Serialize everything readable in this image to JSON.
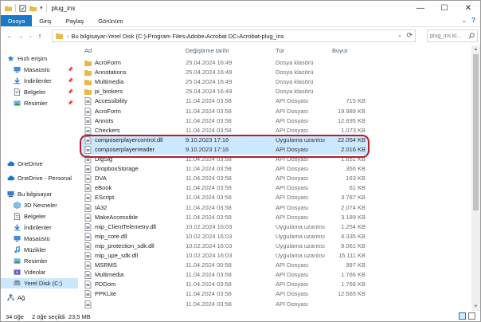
{
  "window": {
    "title": "plug_ins",
    "controls": {
      "minimize": "—",
      "maximize": "☐",
      "close": "✕"
    }
  },
  "ribbon": {
    "tabs": [
      "Dosya",
      "Giriş",
      "Paylaş",
      "Görünüm"
    ],
    "right_chevron": "⌄",
    "help": "?"
  },
  "navigation": {
    "back": "←",
    "forward": "→",
    "recent": "⌄",
    "up": "↑"
  },
  "address": {
    "crumbs": [
      "Bu bilgisayar",
      "Yerel Disk (C:)",
      "Program Files",
      "Adobe",
      "Acrobat DC",
      "Acrobat",
      "plug_ins"
    ],
    "separator": "›",
    "dropdown": "⌄",
    "refresh": "⟳"
  },
  "search": {
    "placeholder": "plug_ins kl..."
  },
  "nav_pane": {
    "items": [
      {
        "label": "Hızlı erişim",
        "icon": "star-icon",
        "pinned": false,
        "selected": false,
        "chevron": ""
      },
      {
        "label": "Masaüstü",
        "icon": "desktop-icon",
        "pinned": true,
        "selected": false,
        "chevron": ""
      },
      {
        "label": "İndirilenler",
        "icon": "download-icon",
        "pinned": true,
        "selected": false,
        "chevron": ""
      },
      {
        "label": "Belgeler",
        "icon": "documents-icon",
        "pinned": true,
        "selected": false,
        "chevron": ""
      },
      {
        "label": "Resimler",
        "icon": "pictures-icon",
        "pinned": true,
        "selected": false,
        "chevron": ""
      },
      {
        "label": "OneDrive",
        "icon": "cloud-icon",
        "pinned": false,
        "selected": false,
        "chevron": ""
      },
      {
        "label": "OneDrive - Personal",
        "icon": "cloud-icon",
        "pinned": false,
        "selected": false,
        "chevron": ""
      },
      {
        "label": "Bu bilgisayar",
        "icon": "computer-icon",
        "pinned": false,
        "selected": false,
        "chevron": ""
      },
      {
        "label": "3D Nesneler",
        "icon": "3d-objects-icon",
        "pinned": false,
        "selected": false,
        "chevron": ""
      },
      {
        "label": "Belgeler",
        "icon": "documents-icon",
        "pinned": false,
        "selected": false,
        "chevron": ""
      },
      {
        "label": "İndirilenler",
        "icon": "download-icon",
        "pinned": false,
        "selected": false,
        "chevron": ""
      },
      {
        "label": "Masaüstü",
        "icon": "desktop-icon",
        "pinned": false,
        "selected": false,
        "chevron": ""
      },
      {
        "label": "Müzikler",
        "icon": "music-icon",
        "pinned": false,
        "selected": false,
        "chevron": ""
      },
      {
        "label": "Resimler",
        "icon": "pictures-icon",
        "pinned": false,
        "selected": false,
        "chevron": ""
      },
      {
        "label": "Videolar",
        "icon": "videos-icon",
        "pinned": false,
        "selected": false,
        "chevron": ""
      },
      {
        "label": "Yerel Disk (C:)",
        "icon": "drive-icon",
        "pinned": false,
        "selected": true,
        "chevron": ""
      },
      {
        "label": "Ağ",
        "icon": "network-icon",
        "pinned": false,
        "selected": false,
        "chevron": ""
      }
    ]
  },
  "file_list": {
    "headers": {
      "name": "Ad",
      "date": "Değiştirme tarihi",
      "type": "Tür",
      "size": "Boyut"
    },
    "rows": [
      {
        "name": "AcroForm",
        "date": "25.04.2024 16:49",
        "type": "Dosya klasörü",
        "size": "",
        "kind": "folder",
        "selected": false
      },
      {
        "name": "Annotations",
        "date": "25.04.2024 16:49",
        "type": "Dosya klasörü",
        "size": "",
        "kind": "folder",
        "selected": false
      },
      {
        "name": "Multimedia",
        "date": "25.04.2024 16:49",
        "type": "Dosya klasörü",
        "size": "",
        "kind": "folder",
        "selected": false
      },
      {
        "name": "pi_brokers",
        "date": "25.04.2024 16:49",
        "type": "Dosya klasörü",
        "size": "",
        "kind": "folder",
        "selected": false
      },
      {
        "name": "Accessibility",
        "date": "11.04.2024 03:58",
        "type": "API Dosyası",
        "size": "715 KB",
        "kind": "file",
        "selected": false
      },
      {
        "name": "AcroForm",
        "date": "11.04.2024 03:58",
        "type": "API Dosyası",
        "size": "19.989 KB",
        "kind": "file",
        "selected": false
      },
      {
        "name": "Annots",
        "date": "11.04.2024 03:58",
        "type": "API Dosyası",
        "size": "12.695 KB",
        "kind": "file",
        "selected": false
      },
      {
        "name": "Checkers",
        "date": "11.04.2024 03:58",
        "type": "API Dosyası",
        "size": "1.073 KB",
        "kind": "file",
        "selected": false
      },
      {
        "name": "composerplayercontrol.dll",
        "date": "9.10.2023 17:16",
        "type": "Uygulama uzantısı",
        "size": "22.054 KB",
        "kind": "file",
        "selected": true
      },
      {
        "name": "composerplayerreader",
        "date": "9.10.2023 17:16",
        "type": "API Dosyası",
        "size": "2.016 KB",
        "kind": "file",
        "selected": true
      },
      {
        "name": "DigSig",
        "date": "11.04.2024 03:58",
        "type": "API Dosyası",
        "size": "1.651 KB",
        "kind": "file",
        "selected": false
      },
      {
        "name": "DropboxStorage",
        "date": "11.04.2024 03:58",
        "type": "API Dosyası",
        "size": "356 KB",
        "kind": "file",
        "selected": false
      },
      {
        "name": "DVA",
        "date": "11.04.2024 03:58",
        "type": "API Dosyası",
        "size": "163 KB",
        "kind": "file",
        "selected": false
      },
      {
        "name": "eBook",
        "date": "11.04.2024 03:58",
        "type": "API Dosyası",
        "size": "61 KB",
        "kind": "file",
        "selected": false
      },
      {
        "name": "EScript",
        "date": "11.04.2024 03:58",
        "type": "API Dosyası",
        "size": "3.787 KB",
        "kind": "file",
        "selected": false
      },
      {
        "name": "IA32",
        "date": "11.04.2024 03:58",
        "type": "API Dosyası",
        "size": "2.074 KB",
        "kind": "file",
        "selected": false
      },
      {
        "name": "MakeAccessible",
        "date": "11.04.2024 03:58",
        "type": "API Dosyası",
        "size": "3.189 KB",
        "kind": "file",
        "selected": false
      },
      {
        "name": "mip_ClientTelemetry.dll",
        "date": "10.02.2024 16:03",
        "type": "Uygulama uzantısı",
        "size": "1.254 KB",
        "kind": "file",
        "selected": false
      },
      {
        "name": "mip_core.dll",
        "date": "10.02.2024 16:03",
        "type": "Uygulama uzantısı",
        "size": "4.335 KB",
        "kind": "file",
        "selected": false
      },
      {
        "name": "mip_protection_sdk.dll",
        "date": "10.02.2024 16:03",
        "type": "Uygulama uzantısı",
        "size": "9.061 KB",
        "kind": "file",
        "selected": false
      },
      {
        "name": "mip_upe_sdk.dll",
        "date": "10.02.2024 16:03",
        "type": "Uygulama uzantısı",
        "size": "15.111 KB",
        "kind": "file",
        "selected": false
      },
      {
        "name": "MSRMS",
        "date": "11.04.2024 00:58",
        "type": "API Dosyası",
        "size": "997 KB",
        "kind": "file",
        "selected": false
      },
      {
        "name": "Multimedia",
        "date": "11.04.2024 03:58",
        "type": "API Dosyası",
        "size": "1.766 KB",
        "kind": "file",
        "selected": false
      },
      {
        "name": "PDDom",
        "date": "11.04.2024 03:58",
        "type": "API Dosyası",
        "size": "1.766 KB",
        "kind": "file",
        "selected": false
      },
      {
        "name": "PPKLite",
        "date": "11.04.2024 03:58",
        "type": "API Dosyası",
        "size": "12.665 KB",
        "kind": "file",
        "selected": false
      },
      {
        "name": "",
        "date": "11.04.2024 03:58",
        "type": "API Dosyası",
        "size": "",
        "kind": "file",
        "selected": false
      }
    ]
  },
  "status": {
    "item_count": "34 öğe",
    "selection": "2 öğe seçildi  23,5 MB"
  },
  "scrollbar": {
    "up": "▲",
    "down": "▼"
  },
  "colors": {
    "file_tab": "#1979ca",
    "selection": "#cce8ff",
    "highlight_ring": "#b21f2d",
    "folder": "#e8b84a"
  }
}
